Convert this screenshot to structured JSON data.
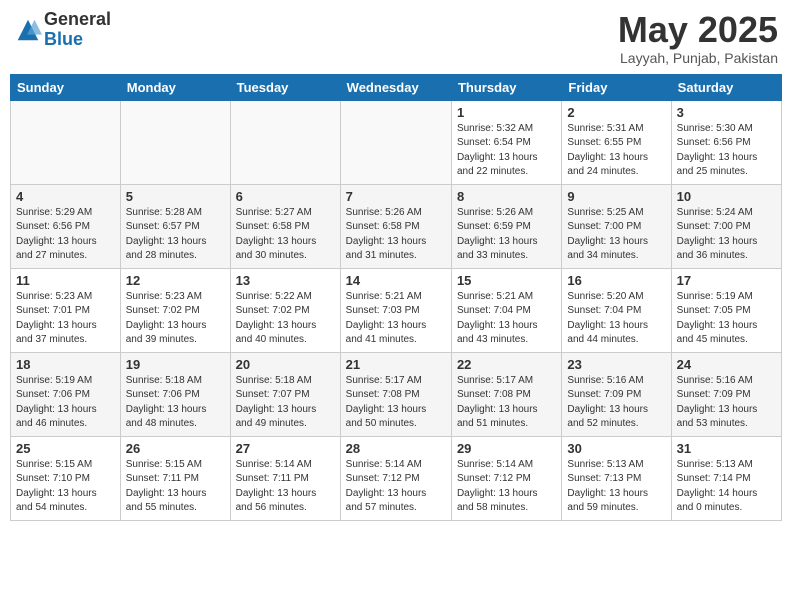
{
  "header": {
    "logo_general": "General",
    "logo_blue": "Blue",
    "month_title": "May 2025",
    "subtitle": "Layyah, Punjab, Pakistan"
  },
  "weekdays": [
    "Sunday",
    "Monday",
    "Tuesday",
    "Wednesday",
    "Thursday",
    "Friday",
    "Saturday"
  ],
  "weeks": [
    [
      {
        "day": "",
        "info": ""
      },
      {
        "day": "",
        "info": ""
      },
      {
        "day": "",
        "info": ""
      },
      {
        "day": "",
        "info": ""
      },
      {
        "day": "1",
        "info": "Sunrise: 5:32 AM\nSunset: 6:54 PM\nDaylight: 13 hours\nand 22 minutes."
      },
      {
        "day": "2",
        "info": "Sunrise: 5:31 AM\nSunset: 6:55 PM\nDaylight: 13 hours\nand 24 minutes."
      },
      {
        "day": "3",
        "info": "Sunrise: 5:30 AM\nSunset: 6:56 PM\nDaylight: 13 hours\nand 25 minutes."
      }
    ],
    [
      {
        "day": "4",
        "info": "Sunrise: 5:29 AM\nSunset: 6:56 PM\nDaylight: 13 hours\nand 27 minutes."
      },
      {
        "day": "5",
        "info": "Sunrise: 5:28 AM\nSunset: 6:57 PM\nDaylight: 13 hours\nand 28 minutes."
      },
      {
        "day": "6",
        "info": "Sunrise: 5:27 AM\nSunset: 6:58 PM\nDaylight: 13 hours\nand 30 minutes."
      },
      {
        "day": "7",
        "info": "Sunrise: 5:26 AM\nSunset: 6:58 PM\nDaylight: 13 hours\nand 31 minutes."
      },
      {
        "day": "8",
        "info": "Sunrise: 5:26 AM\nSunset: 6:59 PM\nDaylight: 13 hours\nand 33 minutes."
      },
      {
        "day": "9",
        "info": "Sunrise: 5:25 AM\nSunset: 7:00 PM\nDaylight: 13 hours\nand 34 minutes."
      },
      {
        "day": "10",
        "info": "Sunrise: 5:24 AM\nSunset: 7:00 PM\nDaylight: 13 hours\nand 36 minutes."
      }
    ],
    [
      {
        "day": "11",
        "info": "Sunrise: 5:23 AM\nSunset: 7:01 PM\nDaylight: 13 hours\nand 37 minutes."
      },
      {
        "day": "12",
        "info": "Sunrise: 5:23 AM\nSunset: 7:02 PM\nDaylight: 13 hours\nand 39 minutes."
      },
      {
        "day": "13",
        "info": "Sunrise: 5:22 AM\nSunset: 7:02 PM\nDaylight: 13 hours\nand 40 minutes."
      },
      {
        "day": "14",
        "info": "Sunrise: 5:21 AM\nSunset: 7:03 PM\nDaylight: 13 hours\nand 41 minutes."
      },
      {
        "day": "15",
        "info": "Sunrise: 5:21 AM\nSunset: 7:04 PM\nDaylight: 13 hours\nand 43 minutes."
      },
      {
        "day": "16",
        "info": "Sunrise: 5:20 AM\nSunset: 7:04 PM\nDaylight: 13 hours\nand 44 minutes."
      },
      {
        "day": "17",
        "info": "Sunrise: 5:19 AM\nSunset: 7:05 PM\nDaylight: 13 hours\nand 45 minutes."
      }
    ],
    [
      {
        "day": "18",
        "info": "Sunrise: 5:19 AM\nSunset: 7:06 PM\nDaylight: 13 hours\nand 46 minutes."
      },
      {
        "day": "19",
        "info": "Sunrise: 5:18 AM\nSunset: 7:06 PM\nDaylight: 13 hours\nand 48 minutes."
      },
      {
        "day": "20",
        "info": "Sunrise: 5:18 AM\nSunset: 7:07 PM\nDaylight: 13 hours\nand 49 minutes."
      },
      {
        "day": "21",
        "info": "Sunrise: 5:17 AM\nSunset: 7:08 PM\nDaylight: 13 hours\nand 50 minutes."
      },
      {
        "day": "22",
        "info": "Sunrise: 5:17 AM\nSunset: 7:08 PM\nDaylight: 13 hours\nand 51 minutes."
      },
      {
        "day": "23",
        "info": "Sunrise: 5:16 AM\nSunset: 7:09 PM\nDaylight: 13 hours\nand 52 minutes."
      },
      {
        "day": "24",
        "info": "Sunrise: 5:16 AM\nSunset: 7:09 PM\nDaylight: 13 hours\nand 53 minutes."
      }
    ],
    [
      {
        "day": "25",
        "info": "Sunrise: 5:15 AM\nSunset: 7:10 PM\nDaylight: 13 hours\nand 54 minutes."
      },
      {
        "day": "26",
        "info": "Sunrise: 5:15 AM\nSunset: 7:11 PM\nDaylight: 13 hours\nand 55 minutes."
      },
      {
        "day": "27",
        "info": "Sunrise: 5:14 AM\nSunset: 7:11 PM\nDaylight: 13 hours\nand 56 minutes."
      },
      {
        "day": "28",
        "info": "Sunrise: 5:14 AM\nSunset: 7:12 PM\nDaylight: 13 hours\nand 57 minutes."
      },
      {
        "day": "29",
        "info": "Sunrise: 5:14 AM\nSunset: 7:12 PM\nDaylight: 13 hours\nand 58 minutes."
      },
      {
        "day": "30",
        "info": "Sunrise: 5:13 AM\nSunset: 7:13 PM\nDaylight: 13 hours\nand 59 minutes."
      },
      {
        "day": "31",
        "info": "Sunrise: 5:13 AM\nSunset: 7:14 PM\nDaylight: 14 hours\nand 0 minutes."
      }
    ]
  ]
}
